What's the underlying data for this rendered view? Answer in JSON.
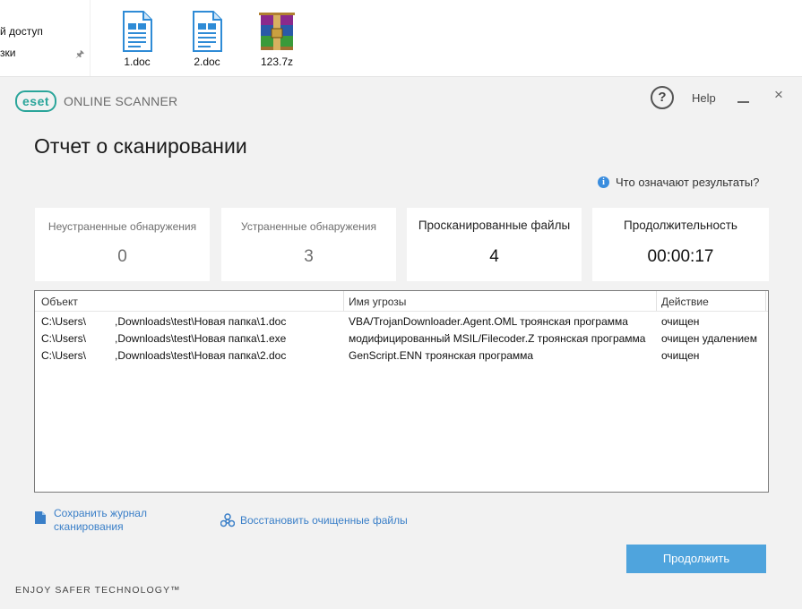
{
  "explorer": {
    "nav_items": [
      "й доступ",
      "зки"
    ],
    "files": [
      {
        "name": "1.doc",
        "icon": "document-icon"
      },
      {
        "name": "2.doc",
        "icon": "document-icon"
      },
      {
        "name": "123.7z",
        "icon": "archive-icon"
      }
    ]
  },
  "app": {
    "logo_badge": "eset",
    "logo_text": "ONLINE SCANNER",
    "help_label": "Help",
    "help_icon_glyph": "?",
    "close_glyph": "×"
  },
  "page": {
    "title": "Отчет о сканировании",
    "results_help": "Что означают результаты?",
    "info_glyph": "i"
  },
  "stats": [
    {
      "label": "Неустраненные обнаружения",
      "value": "0"
    },
    {
      "label": "Устраненные обнаружения",
      "value": "3"
    },
    {
      "label": "Просканированные файлы",
      "value": "4"
    },
    {
      "label": "Продолжительность",
      "value": "00:00:17"
    }
  ],
  "table": {
    "columns": [
      "Объект",
      "Имя угрозы",
      "Действие"
    ],
    "rows": [
      {
        "user": "C:\\Users\\",
        "path": ",Downloads\\test\\Новая папка\\1.doc",
        "threat": "VBA/TrojanDownloader.Agent.OML троянская программа",
        "action": "очищен"
      },
      {
        "user": "C:\\Users\\",
        "path": ",Downloads\\test\\Новая папка\\1.exe",
        "threat": "модифицированный MSIL/Filecoder.Z троянская программа",
        "action": "очищен удалением"
      },
      {
        "user": "C:\\Users\\",
        "path": ",Downloads\\test\\Новая папка\\2.doc",
        "threat": "GenScript.ENN троянская программа",
        "action": "очищен"
      }
    ]
  },
  "actions": {
    "save_log_line1": "Сохранить журнал",
    "save_log_line2": "сканирования",
    "restore": "Восстановить очищенные файлы",
    "continue": "Продолжить"
  },
  "footer": "ENJOY SAFER TECHNOLOGY™",
  "colors": {
    "brand": "#2aa59a",
    "link": "#3a7fc8",
    "button": "#4fa4dd",
    "background": "#f2f2f2"
  }
}
